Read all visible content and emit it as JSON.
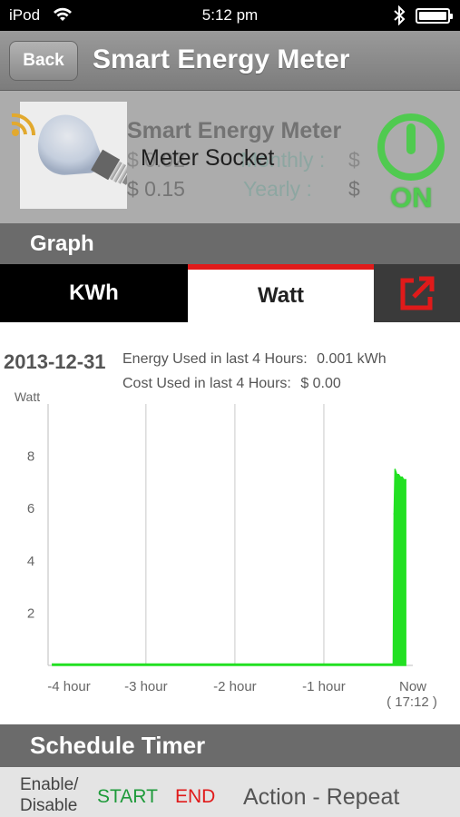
{
  "status_bar": {
    "carrier": "iPod",
    "time": "5:12 pm"
  },
  "nav": {
    "back_label": "Back",
    "title": "Smart Energy Meter"
  },
  "device": {
    "header": "Smart Energy Meter",
    "name": "Meter Socket",
    "cost_value_1": "$ 0.02",
    "monthly_label": "Monthly :",
    "currency_monthly": "$",
    "cost_value_2": "$   0.15",
    "yearly_label": "Yearly :",
    "currency_yearly": "$",
    "power_state": "ON",
    "on_color": "#2ed12e"
  },
  "graph_section": {
    "title": "Graph"
  },
  "tabs": [
    {
      "label": "KWh",
      "selected": false
    },
    {
      "label": "Watt",
      "selected": true
    }
  ],
  "export_icon": "external-link-icon",
  "summary": {
    "date": "2013-12-31",
    "energy_label": "Energy Used in last 4 Hours:",
    "energy_value": "0.001 kWh",
    "cost_label": "Cost Used in last 4 Hours:",
    "cost_value": "$  0.00"
  },
  "chart_data": {
    "type": "area",
    "ylabel": "Watt",
    "xlabel": "",
    "x_ticks": [
      "-4 hour",
      "-3 hour",
      "-2 hour",
      "-1 hour",
      "Now"
    ],
    "now_time": "( 17:12 )",
    "y_ticks": [
      2,
      4,
      6,
      8
    ],
    "ylim": [
      0,
      10
    ],
    "xlim": [
      -4.1,
      0
    ],
    "grid": true,
    "series": [
      {
        "color": "#22e022",
        "x": [
          -4.05,
          -3.0,
          -2.0,
          -1.0,
          -0.22,
          -0.21,
          -0.2,
          -0.19,
          -0.18,
          -0.16,
          -0.14,
          -0.12,
          -0.1,
          -0.08
        ],
        "y": [
          0.05,
          0.05,
          0.05,
          0.05,
          0.05,
          5.8,
          7.5,
          7.4,
          7.3,
          7.3,
          7.2,
          7.2,
          7.1,
          7.1
        ]
      }
    ]
  },
  "schedule_section": {
    "title": "Schedule Timer",
    "enable_line1": "Enable/",
    "enable_line2": "Disable",
    "start_label": "START",
    "end_label": "END",
    "action_label": "Action - Repeat"
  }
}
